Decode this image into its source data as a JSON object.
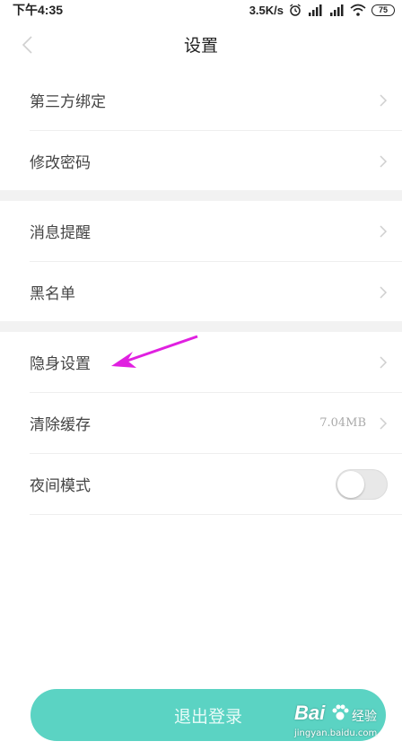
{
  "status_bar": {
    "time": "下午4:35",
    "net_speed": "3.5K/s",
    "battery": "75"
  },
  "header": {
    "title": "设置",
    "back_icon": "chevron-left-icon"
  },
  "sections": [
    {
      "items": [
        {
          "label": "第三方绑定"
        },
        {
          "label": "修改密码"
        }
      ]
    },
    {
      "items": [
        {
          "label": "消息提醒"
        },
        {
          "label": "黑名单"
        }
      ]
    },
    {
      "items": [
        {
          "label": "隐身设置"
        },
        {
          "label": "清除缓存",
          "value": "7.04MB"
        },
        {
          "label": "夜间模式",
          "toggle": false
        }
      ]
    }
  ],
  "logout_label": "退出登录",
  "watermark": {
    "brand": "Bai",
    "brand_suffix": "经验",
    "url": "jingyan.baidu.com"
  },
  "colors": {
    "accent": "#5bd3c3",
    "annotation_arrow": "#e020e0"
  }
}
